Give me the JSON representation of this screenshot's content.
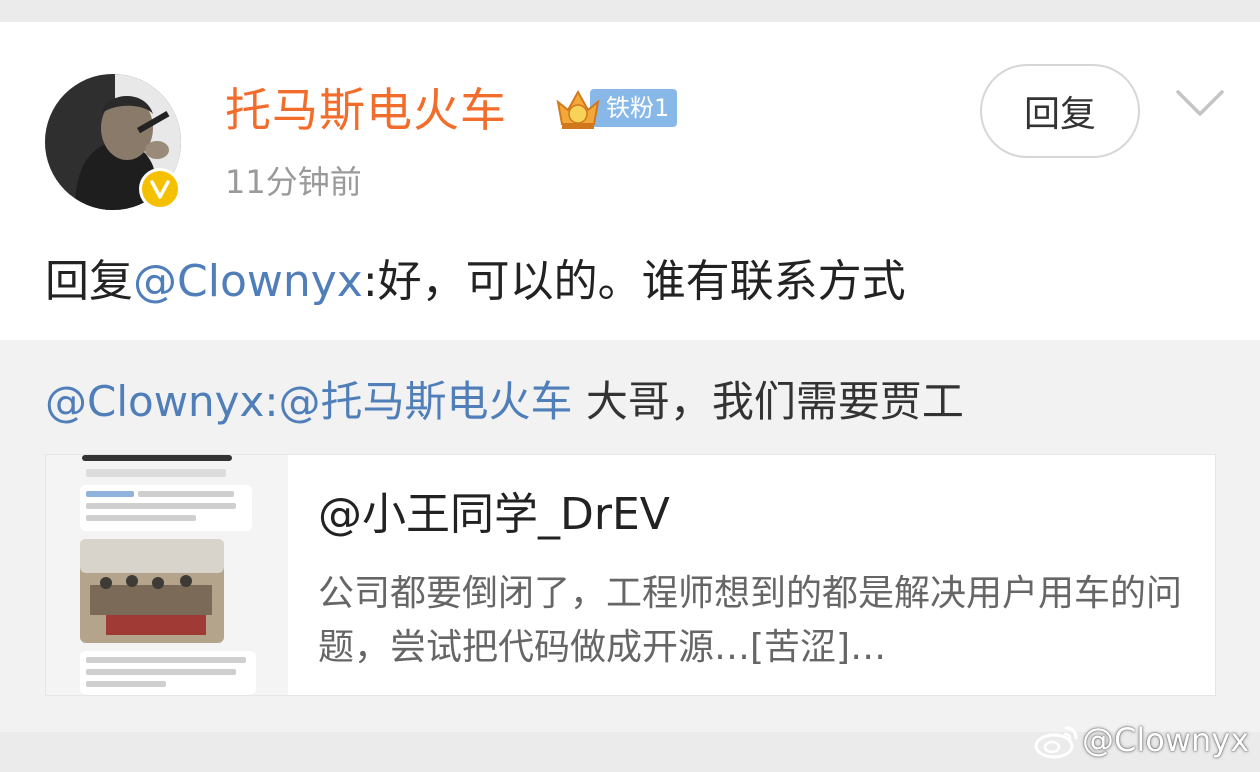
{
  "post": {
    "username": "托马斯电火车",
    "fan_badge": "铁粉1",
    "timestamp": "11分钟前",
    "reply_button": "回复",
    "comment_prefix": "回复",
    "comment_mention": "@Clownyx",
    "comment_body": ":好，可以的。谁有联系方式"
  },
  "quoted": {
    "mention": "@Clownyx:@托马斯电火车",
    "body": " 大哥，我们需要贾工",
    "link_card": {
      "title": "@小王同学_DrEV",
      "description": "公司都要倒闭了，工程师想到的都是解决用户用车的问题，尝试把代码做成开源…[苦涩]…"
    }
  },
  "watermark": "@Clownyx",
  "colors": {
    "username": "#f26d2b",
    "mention": "#4f7eb8",
    "fan_badge": "#88b8e8",
    "verified_badge": "#f5c000",
    "background": "#ebebeb",
    "quoted_background": "#f2f2f2"
  },
  "icons": {
    "verified": "verified-v-icon",
    "crown": "crown-icon",
    "chevron": "chevron-down-icon",
    "watermark_logo": "weibo-logo-icon"
  }
}
